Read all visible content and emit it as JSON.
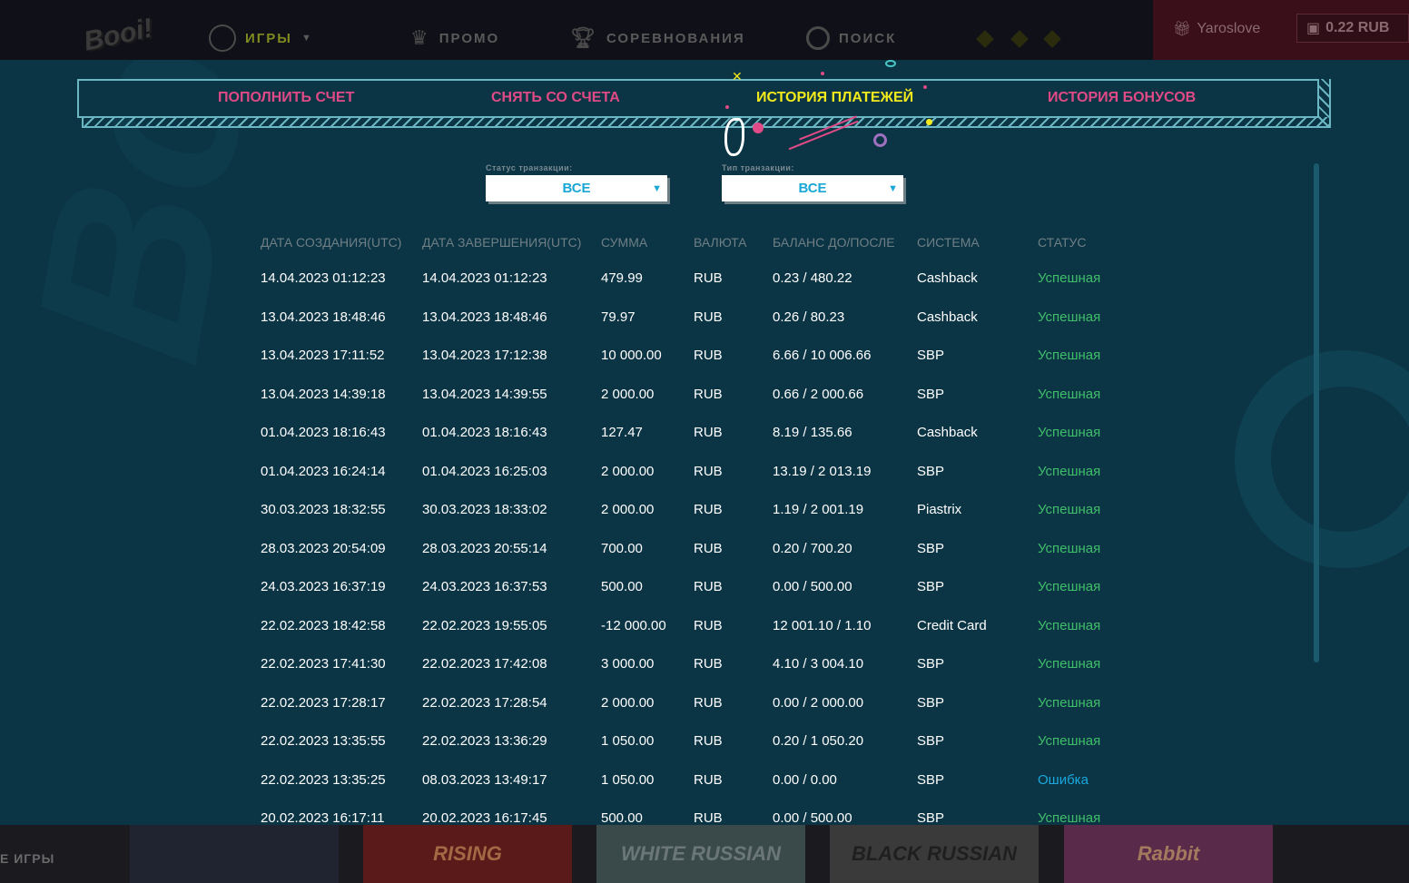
{
  "nav": {
    "logo": "Booi!",
    "items": [
      {
        "label": "ИГРЫ",
        "icon": "roulette-icon"
      },
      {
        "label": "ПРОМО",
        "icon": "crown-icon"
      },
      {
        "label": "СОРЕВНОВАНИЯ",
        "icon": "trophy-icon"
      },
      {
        "label": "ПОИСК",
        "icon": "search-icon"
      }
    ],
    "username": "Yaroslove",
    "balance": "0.22 RUB"
  },
  "tabs": [
    {
      "label": "ПОПОЛНИТЬ СЧЕТ"
    },
    {
      "label": "СНЯТЬ СО СЧЕТА"
    },
    {
      "label": "ИСТОРИЯ ПЛАТЕЖЕЙ",
      "active": true
    },
    {
      "label": "ИСТОРИЯ БОНУСОВ"
    }
  ],
  "filters": {
    "status": {
      "label": "Статус транзакции:",
      "value": "ВСЕ"
    },
    "type": {
      "label": "Тип транзакции:",
      "value": "ВСЕ"
    }
  },
  "table": {
    "headers": [
      "ДАТА СОЗДАНИЯ(UTC)",
      "ДАТА ЗАВЕРШЕНИЯ(UTC)",
      "СУММА",
      "ВАЛЮТА",
      "БАЛАНС ДО/ПОСЛЕ",
      "СИСТЕМА",
      "СТАТУС"
    ],
    "rows": [
      [
        "14.04.2023 01:12:23",
        "14.04.2023 01:12:23",
        "479.99",
        "RUB",
        "0.23 / 480.22",
        "Cashback",
        "Успешная"
      ],
      [
        "13.04.2023 18:48:46",
        "13.04.2023 18:48:46",
        "79.97",
        "RUB",
        "0.26 / 80.23",
        "Cashback",
        "Успешная"
      ],
      [
        "13.04.2023 17:11:52",
        "13.04.2023 17:12:38",
        "10 000.00",
        "RUB",
        "6.66 / 10 006.66",
        "SBP",
        "Успешная"
      ],
      [
        "13.04.2023 14:39:18",
        "13.04.2023 14:39:55",
        "2 000.00",
        "RUB",
        "0.66 / 2 000.66",
        "SBP",
        "Успешная"
      ],
      [
        "01.04.2023 18:16:43",
        "01.04.2023 18:16:43",
        "127.47",
        "RUB",
        "8.19 / 135.66",
        "Cashback",
        "Успешная"
      ],
      [
        "01.04.2023 16:24:14",
        "01.04.2023 16:25:03",
        "2 000.00",
        "RUB",
        "13.19 / 2 013.19",
        "SBP",
        "Успешная"
      ],
      [
        "30.03.2023 18:32:55",
        "30.03.2023 18:33:02",
        "2 000.00",
        "RUB",
        "1.19 / 2 001.19",
        "Piastrix",
        "Успешная"
      ],
      [
        "28.03.2023 20:54:09",
        "28.03.2023 20:55:14",
        "700.00",
        "RUB",
        "0.20 / 700.20",
        "SBP",
        "Успешная"
      ],
      [
        "24.03.2023 16:37:19",
        "24.03.2023 16:37:53",
        "500.00",
        "RUB",
        "0.00 / 500.00",
        "SBP",
        "Успешная"
      ],
      [
        "22.02.2023 18:42:58",
        "22.02.2023 19:55:05",
        "-12 000.00",
        "RUB",
        "12 001.10 / 1.10",
        "Credit Card",
        "Успешная"
      ],
      [
        "22.02.2023 17:41:30",
        "22.02.2023 17:42:08",
        "3 000.00",
        "RUB",
        "4.10 / 3 004.10",
        "SBP",
        "Успешная"
      ],
      [
        "22.02.2023 17:28:17",
        "22.02.2023 17:28:54",
        "2 000.00",
        "RUB",
        "0.00 / 2 000.00",
        "SBP",
        "Успешная"
      ],
      [
        "22.02.2023 13:35:55",
        "22.02.2023 13:36:29",
        "1 050.00",
        "RUB",
        "0.20 / 1 050.20",
        "SBP",
        "Успешная"
      ],
      [
        "22.02.2023 13:35:25",
        "08.03.2023 13:49:17",
        "1 050.00",
        "RUB",
        "0.00 / 0.00",
        "SBP",
        "Ошибка"
      ],
      [
        "20.02.2023 16:17:11",
        "20.02.2023 16:17:45",
        "500.00",
        "RUB",
        "0.00 / 500.00",
        "SBP",
        "Успешная"
      ]
    ]
  },
  "bottom": {
    "games_label": "Е ИГРЫ",
    "thumbs": [
      "RISING",
      "WHITE RUSSIAN",
      "BLACK RUSSIAN",
      "Rabbit"
    ]
  },
  "colors": {
    "modal_bg": "#0b3444",
    "tab_inactive": "#e04a86",
    "tab_active": "#f2ea1c",
    "status_ok": "#3fbf6a",
    "status_error": "#1aa9de"
  }
}
